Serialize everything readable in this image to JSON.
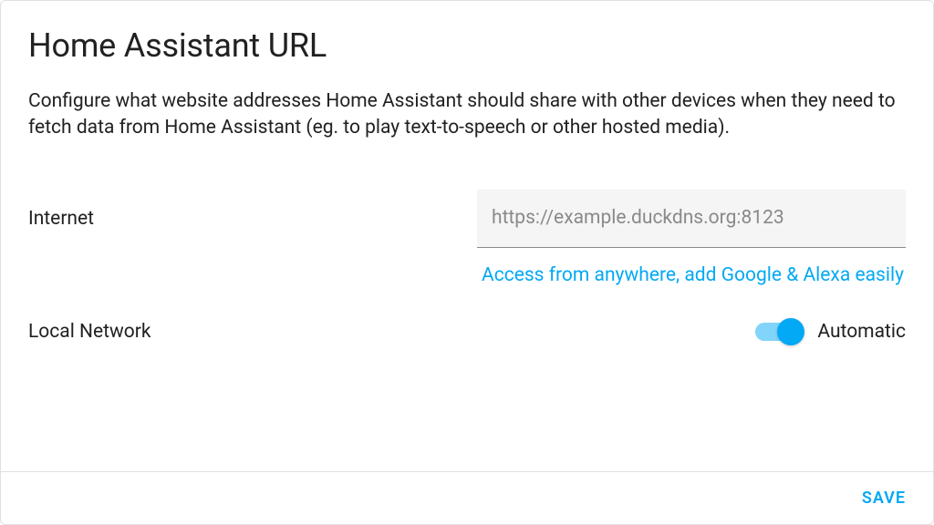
{
  "header": {
    "title": "Home Assistant URL",
    "description": "Configure what website addresses Home Assistant should share with other devices when they need to fetch data from Home Assistant (eg. to play text-to-speech or other hosted media)."
  },
  "internet": {
    "label": "Internet",
    "placeholder": "https://example.duckdns.org:8123",
    "value": ""
  },
  "access_link": {
    "text": "Access from anywhere, add Google & Alexa easily"
  },
  "local_network": {
    "label": "Local Network",
    "toggle_label": "Automatic",
    "enabled": true
  },
  "footer": {
    "save_label": "SAVE"
  },
  "colors": {
    "accent": "#03a9f4"
  }
}
